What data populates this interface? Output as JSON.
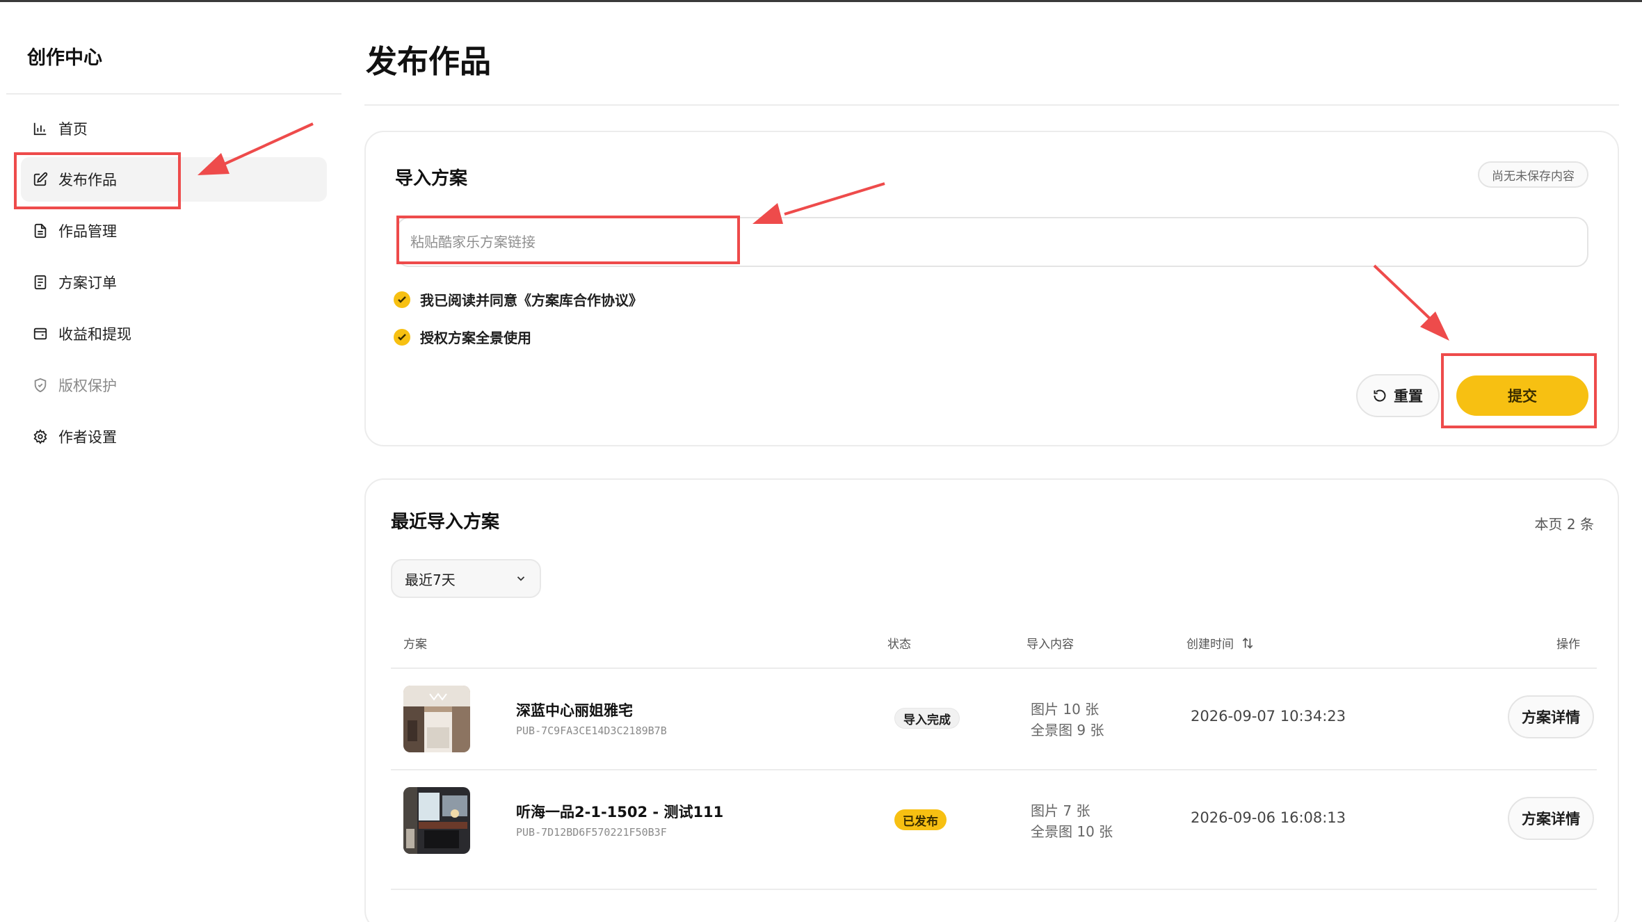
{
  "sidebar": {
    "brand": "创作中心",
    "items": [
      {
        "label": "首页",
        "icon": "bar-chart-icon"
      },
      {
        "label": "发布作品",
        "icon": "edit-icon"
      },
      {
        "label": "作品管理",
        "icon": "document-icon"
      },
      {
        "label": "方案订单",
        "icon": "list-document-icon"
      },
      {
        "label": "收益和提现",
        "icon": "wallet-icon"
      },
      {
        "label": "版权保护",
        "icon": "shield-icon"
      },
      {
        "label": "作者设置",
        "icon": "gear-icon"
      }
    ]
  },
  "page": {
    "title": "发布作品"
  },
  "import_card": {
    "title": "导入方案",
    "saved_badge": "尚无未保存内容",
    "link_placeholder": "粘贴酷家乐方案链接",
    "agree_label": "我已阅读并同意《方案库合作协议》",
    "authorize_label": "授权方案全景使用",
    "reset_label": "重置",
    "submit_label": "提交"
  },
  "recent_card": {
    "title": "最近导入方案",
    "page_count": "本页 2 条",
    "filter_value": "最近7天",
    "columns": {
      "plan": "方案",
      "status": "状态",
      "content": "导入内容",
      "created": "创建时间",
      "actions": "操作"
    },
    "rows": [
      {
        "name": "深蓝中心丽姐雅宅",
        "id": "PUB-7C9FA3CE14D3C2189B7B",
        "status": "导入完成",
        "content_images": "图片 10 张",
        "content_panoramas": "全景图 9 张",
        "created": "2026-09-07 10:34:23",
        "action": "方案详情"
      },
      {
        "name": "听海一品2-1-1502 - 测试111",
        "id": "PUB-7D12BD6F570221F50B3F",
        "status": "已发布",
        "content_images": "图片 7 张",
        "content_panoramas": "全景图 10 张",
        "created": "2026-09-06 16:08:13",
        "action": "方案详情"
      }
    ]
  },
  "colors": {
    "accent_yellow": "#f7c012",
    "annotation_red": "#ee4b4b"
  }
}
